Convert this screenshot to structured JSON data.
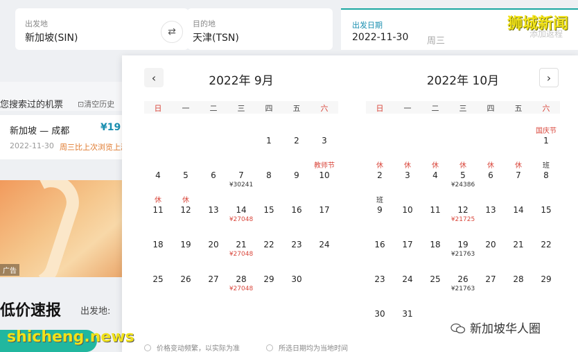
{
  "search": {
    "from_label": "出发地",
    "from_value": "新加坡(SIN)",
    "to_label": "目的地",
    "to_value": "天津(TSN)",
    "date_label": "出发日期",
    "date_value": "2022-11-30",
    "weekday_hint": "周三",
    "add_return": "添加返程"
  },
  "sidebar": {
    "history_title": "您搜索过的机票",
    "clear_history": "清空历史",
    "item": {
      "route": "新加坡 — 成都",
      "price": "¥19",
      "date": "2022-11-30",
      "note": "周三比上次浏览上涨"
    },
    "ad_tag": "广告",
    "deals_title": "低价速报",
    "deals_from": "出发地:"
  },
  "calendar": {
    "weekdays": [
      "日",
      "一",
      "二",
      "三",
      "四",
      "五",
      "六"
    ],
    "months": [
      {
        "title": "2022年 9月",
        "first_weekday": 4,
        "days": 30,
        "rows": 5,
        "tags": {
          "10": "教师节",
          "11": "休",
          "12": "休"
        },
        "work_tags": {},
        "prices": {
          "7": "¥30241",
          "14": "¥27048",
          "21": "¥27048",
          "28": "¥27048"
        },
        "red_prices": [
          "14",
          "21",
          "28"
        ]
      },
      {
        "title": "2022年 10月",
        "first_weekday": 6,
        "days": 31,
        "rows": 6,
        "tags": {
          "1": "国庆节",
          "2": "休",
          "3": "休",
          "4": "休",
          "5": "休",
          "6": "休",
          "7": "休"
        },
        "work_tags": {
          "8": "班",
          "9": "班"
        },
        "prices": {
          "5": "¥24386",
          "12": "¥21725",
          "19": "¥21763",
          "26": "¥21763"
        },
        "red_prices": [
          "12"
        ]
      }
    ],
    "footnote_left": "价格变动频繁，以实际为准",
    "footnote_right": "所选日期均为当地时间"
  },
  "watermarks": {
    "top": "狮城新闻",
    "bottom": "shicheng.news",
    "wechat": "新加坡华人圈"
  }
}
